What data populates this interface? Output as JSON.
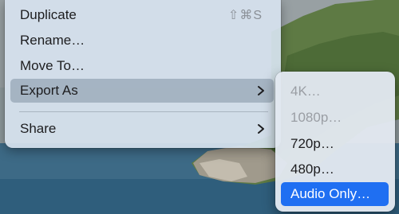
{
  "context_menu": {
    "items": [
      {
        "label": "Duplicate",
        "shortcut": "⇧⌘S"
      },
      {
        "label": "Rename…"
      },
      {
        "label": "Move To…"
      },
      {
        "label": "Export As",
        "has_submenu": true,
        "highlighted": true
      },
      {
        "label": "Share",
        "has_submenu": true
      }
    ]
  },
  "export_submenu": {
    "items": [
      {
        "label": "4K…",
        "enabled": false
      },
      {
        "label": "1080p…",
        "enabled": false
      },
      {
        "label": "720p…",
        "enabled": true
      },
      {
        "label": "480p…",
        "enabled": true
      },
      {
        "label": "Audio Only…",
        "enabled": true,
        "selected": true
      }
    ]
  },
  "icons": {
    "submenu_indicator": "chevron-right-icon"
  },
  "colors": {
    "selection_blue": "#1f6ff2",
    "disabled_text": "#9a9ea4",
    "menu_highlight": "#96a5b6"
  }
}
